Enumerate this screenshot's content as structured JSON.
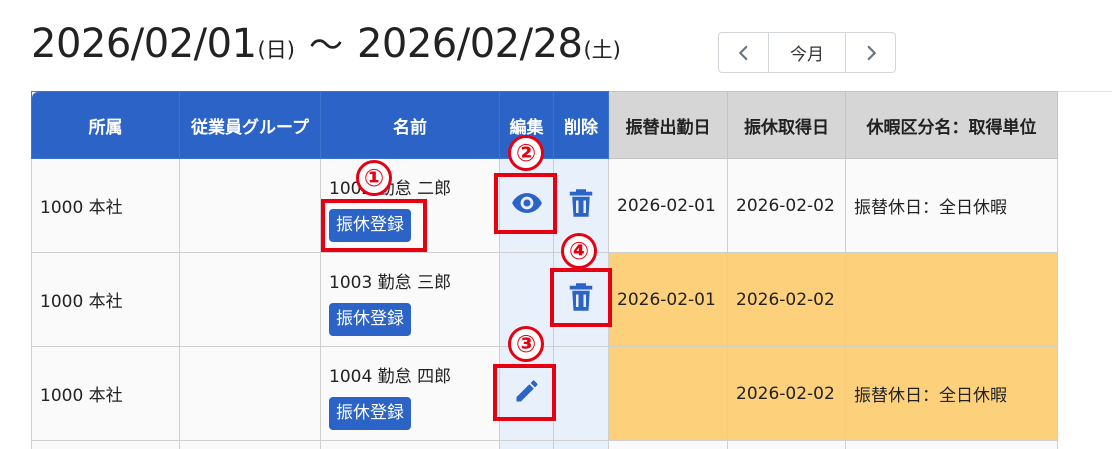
{
  "period": {
    "start": "2026/02/01",
    "start_day": "(日)",
    "separator": "〜",
    "end": "2026/02/28",
    "end_day": "(土)"
  },
  "month_nav": {
    "prev_icon": "chevron-left-icon",
    "today_label": "今月",
    "next_icon": "chevron-right-icon"
  },
  "table": {
    "headers": {
      "dept": "所属",
      "group": "従業員グループ",
      "name": "名前",
      "edit": "編集",
      "delete": "削除",
      "work_date": "振替出勤日",
      "leave_date": "振休取得日",
      "leave_type": "休暇区分名：取得単位"
    },
    "register_label": "振休登録",
    "rows": [
      {
        "dept": "1000 本社",
        "group": "",
        "name": "1002 勤怠 二郎",
        "edit_icon": "eye-icon",
        "delete_icon": "trash-icon",
        "work_date": "2026-02-01",
        "leave_date": "2026-02-02",
        "leave_type": "振替休日：全日休暇"
      },
      {
        "dept": "1000 本社",
        "group": "",
        "name": "1003 勤怠 三郎",
        "edit_icon": "",
        "delete_icon": "trash-icon",
        "work_date": "2026-02-01",
        "leave_date": "2026-02-02",
        "leave_type": ""
      },
      {
        "dept": "1000 本社",
        "group": "",
        "name": "1004 勤怠 四郎",
        "edit_icon": "pencil-icon",
        "delete_icon": "",
        "work_date": "",
        "leave_date": "2026-02-02",
        "leave_type": "振替休日：全日休暇"
      }
    ]
  },
  "annotations": {
    "marker_1": "①",
    "marker_2": "②",
    "marker_3": "③",
    "marker_4": "④"
  },
  "colors": {
    "header_blue": "#2b63c7",
    "highlight": "#fdd17c",
    "action_column": "#e8f0fb",
    "annotation_red": "#e60012"
  }
}
